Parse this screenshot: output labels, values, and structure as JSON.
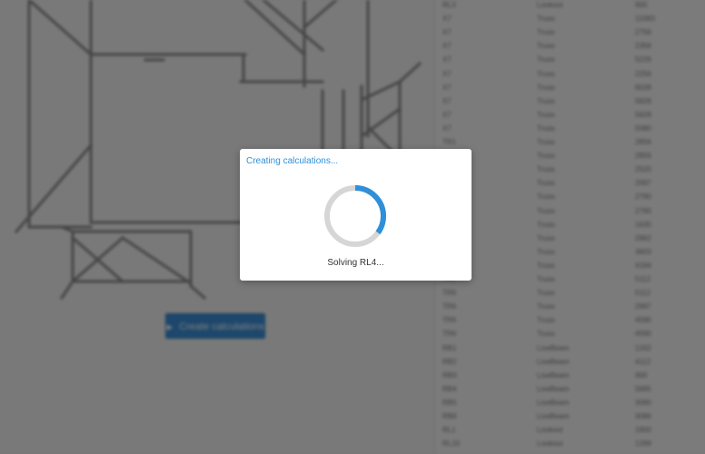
{
  "dialog": {
    "title": "Creating calculations...",
    "status": "Solving RL4...",
    "spinner_progress": 0.35,
    "spinner_color": "#2f8fd8",
    "track_color": "#d6d6d6"
  },
  "background": {
    "calc_button_label": "Create calculations",
    "calc_button_icon": "play-icon",
    "member_rows": [
      {
        "name": "RL3",
        "type": "Lookout",
        "length": "900"
      },
      {
        "name": "X7",
        "type": "Truss",
        "length": "11083"
      },
      {
        "name": "X7",
        "type": "Truss",
        "length": "2756"
      },
      {
        "name": "X7",
        "type": "Truss",
        "length": "2356"
      },
      {
        "name": "X7",
        "type": "Truss",
        "length": "5226"
      },
      {
        "name": "X7",
        "type": "Truss",
        "length": "2256"
      },
      {
        "name": "X7",
        "type": "Truss",
        "length": "6028"
      },
      {
        "name": "X7",
        "type": "Truss",
        "length": "5828"
      },
      {
        "name": "X7",
        "type": "Truss",
        "length": "5628"
      },
      {
        "name": "X7",
        "type": "Truss",
        "length": "5080"
      },
      {
        "name": "TR1",
        "type": "Truss",
        "length": "2856"
      },
      {
        "name": "TR1",
        "type": "Truss",
        "length": "2856"
      },
      {
        "name": "TR1",
        "type": "Truss",
        "length": "2520"
      },
      {
        "name": "TR1",
        "type": "Truss",
        "length": "2097"
      },
      {
        "name": "TR1",
        "type": "Truss",
        "length": "2790"
      },
      {
        "name": "TR1",
        "type": "Truss",
        "length": "2790"
      },
      {
        "name": "TR1",
        "type": "Truss",
        "length": "1630"
      },
      {
        "name": "TR1",
        "type": "Truss",
        "length": "2962"
      },
      {
        "name": "TR1",
        "type": "Truss",
        "length": "3603"
      },
      {
        "name": "TR1",
        "type": "Truss",
        "length": "4194"
      },
      {
        "name": "TR1",
        "type": "Truss",
        "length": "5112"
      },
      {
        "name": "TR6",
        "type": "Truss",
        "length": "5112"
      },
      {
        "name": "TR6",
        "type": "Truss",
        "length": "2997"
      },
      {
        "name": "TR6",
        "type": "Truss",
        "length": "4590"
      },
      {
        "name": "TR6",
        "type": "Truss",
        "length": "4590"
      },
      {
        "name": "RB1",
        "type": "LiveBeam",
        "length": "1332"
      },
      {
        "name": "RB2",
        "type": "LiveBeam",
        "length": "4112"
      },
      {
        "name": "RB3",
        "type": "LiveBeam",
        "length": "900"
      },
      {
        "name": "RB4",
        "type": "LiveBeam",
        "length": "5685"
      },
      {
        "name": "RB5",
        "type": "LiveBeam",
        "length": "3090"
      },
      {
        "name": "RB6",
        "type": "LiveBeam",
        "length": "3086"
      },
      {
        "name": "RL1",
        "type": "Lookout",
        "length": "1900"
      },
      {
        "name": "RL10",
        "type": "Lookout",
        "length": "1299"
      }
    ]
  }
}
